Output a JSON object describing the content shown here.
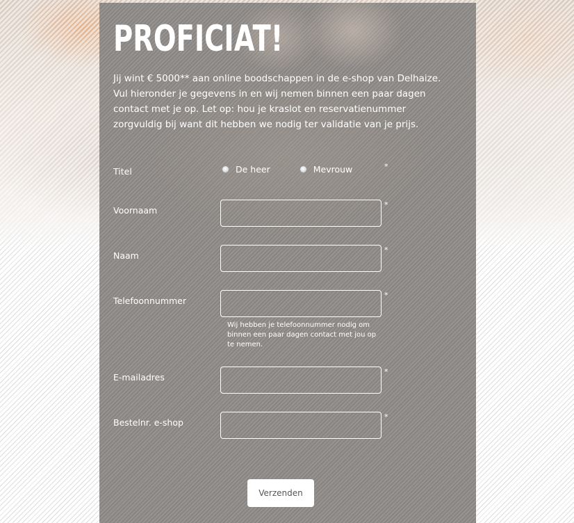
{
  "page": {
    "title": "PROFICIAT!",
    "intro": "Jij wint € 5000** aan online boodschappen in de e-shop van Delhaize. Vul hieronder je gegevens in en wij nemen binnen een paar dagen contact met je op. Let op: hou je kraslot en reservatienummer zorgvuldig bij want dit hebben we nodig ter validatie van je prijs."
  },
  "form": {
    "required_mark": "*",
    "title_label": "Titel",
    "radio_options": [
      "De heer",
      "Mevrouw"
    ],
    "firstname_label": "Voornaam",
    "firstname_value": "",
    "lastname_label": "Naam",
    "lastname_value": "",
    "phone_label": "Telefoonnummer",
    "phone_value": "",
    "phone_hint": "Wij hebben je telefoonnummer nodig om binnen een paar dagen contact met jou op te nemen.",
    "email_label": "E-mailadres",
    "email_value": "",
    "order_label": "Bestelnr. e-shop",
    "order_value": "",
    "submit_label": "Verzenden"
  },
  "colors": {
    "panel": "#8f8b88",
    "text": "#ffffff",
    "button_text": "#555555"
  }
}
